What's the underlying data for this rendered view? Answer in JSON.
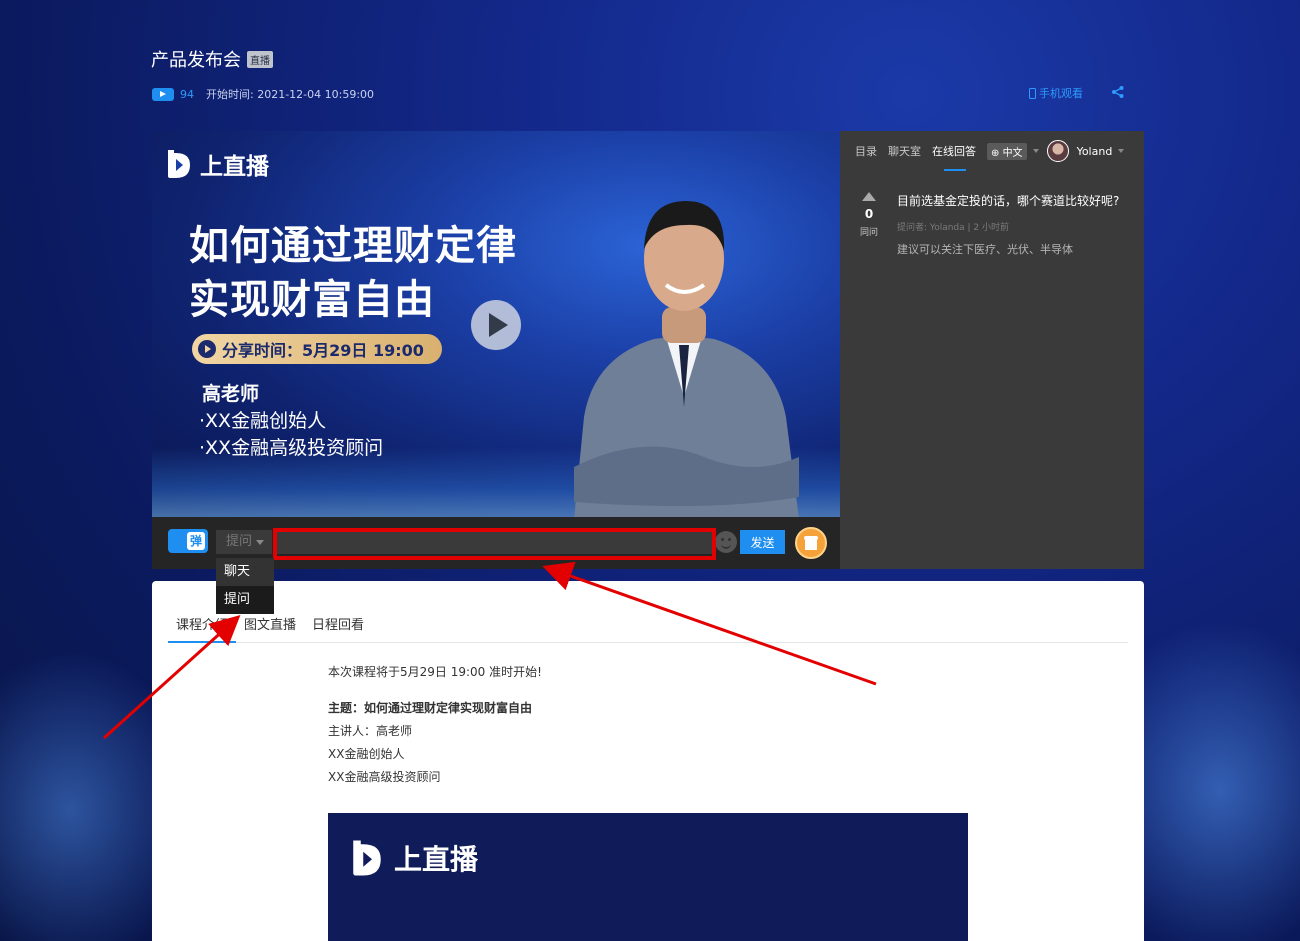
{
  "header": {
    "title": "产品发布会",
    "live_badge": "直播",
    "view_count": "94",
    "start_time": "开始时间: 2021-12-04 10:59:00",
    "mobile_watch": "手机观看"
  },
  "player": {
    "brand": "上直播",
    "headline_line1": "如何通过理财定律",
    "headline_line2": "实现财富自由",
    "share_time": "分享时间：5月29日 19:00",
    "speaker_name": "高老师",
    "speaker_line1": "·XX金融创始人",
    "speaker_line2": "·XX金融高级投资顾问"
  },
  "control_bar": {
    "danmu_label": "弹",
    "mode_value": "提问",
    "input_value": "",
    "send_label": "发送",
    "dropdown_options": [
      "聊天",
      "提问"
    ]
  },
  "side_panel": {
    "tabs": [
      "目录",
      "聊天室",
      "在线回答"
    ],
    "active_tab": "在线回答",
    "language": "中文",
    "user_name": "Yoland",
    "qa": {
      "votes": "0",
      "vote_label": "同问",
      "question": "目前选基金定投的话，哪个赛道比较好呢?",
      "asker": "提问者:    Yolanda   |   2 小时前",
      "answer": "建议可以关注下医疗、光伏、半导体"
    }
  },
  "content": {
    "tabs": [
      "课程介绍",
      "图文直播",
      "日程回看"
    ],
    "active_tab": "课程介绍",
    "lead": "本次课程将于5月29日 19:00 准时开始!",
    "topic": "主题：如何通过理财定律实现财富自由",
    "presenter": "主讲人：高老师",
    "line1": "XX金融创始人",
    "line2": "XX金融高级投资顾问",
    "banner_brand": "上直播"
  },
  "colors": {
    "accent": "#1e8ff0",
    "highlight": "#e30000",
    "panel_dark": "#3a3a3a"
  }
}
